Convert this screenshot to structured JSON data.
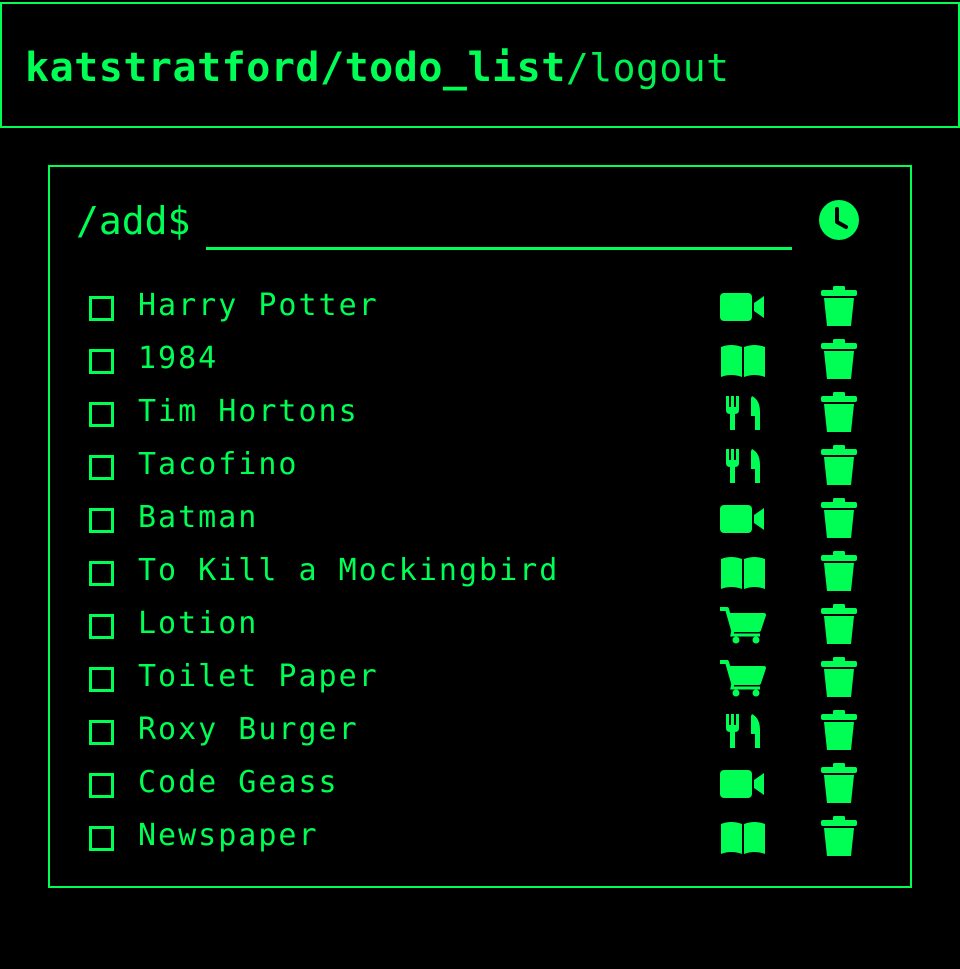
{
  "header": {
    "brand": "katstratford/todo_list",
    "logout": "/logout"
  },
  "add": {
    "prompt": "/add$",
    "value": "",
    "placeholder": ""
  },
  "colors": {
    "accent": "#00ff55",
    "background": "#000000"
  },
  "todos": [
    {
      "text": "Harry Potter",
      "category_icon": "video-camera-icon"
    },
    {
      "text": "1984",
      "category_icon": "book-icon"
    },
    {
      "text": "Tim Hortons",
      "category_icon": "utensils-icon"
    },
    {
      "text": "Tacofino",
      "category_icon": "utensils-icon"
    },
    {
      "text": "Batman",
      "category_icon": "video-camera-icon"
    },
    {
      "text": "To Kill a Mockingbird",
      "category_icon": "book-icon"
    },
    {
      "text": "Lotion",
      "category_icon": "shopping-cart-icon"
    },
    {
      "text": "Toilet Paper",
      "category_icon": "shopping-cart-icon"
    },
    {
      "text": "Roxy Burger",
      "category_icon": "utensils-icon"
    },
    {
      "text": "Code Geass",
      "category_icon": "video-camera-icon"
    },
    {
      "text": "Newspaper",
      "category_icon": "book-icon"
    }
  ]
}
